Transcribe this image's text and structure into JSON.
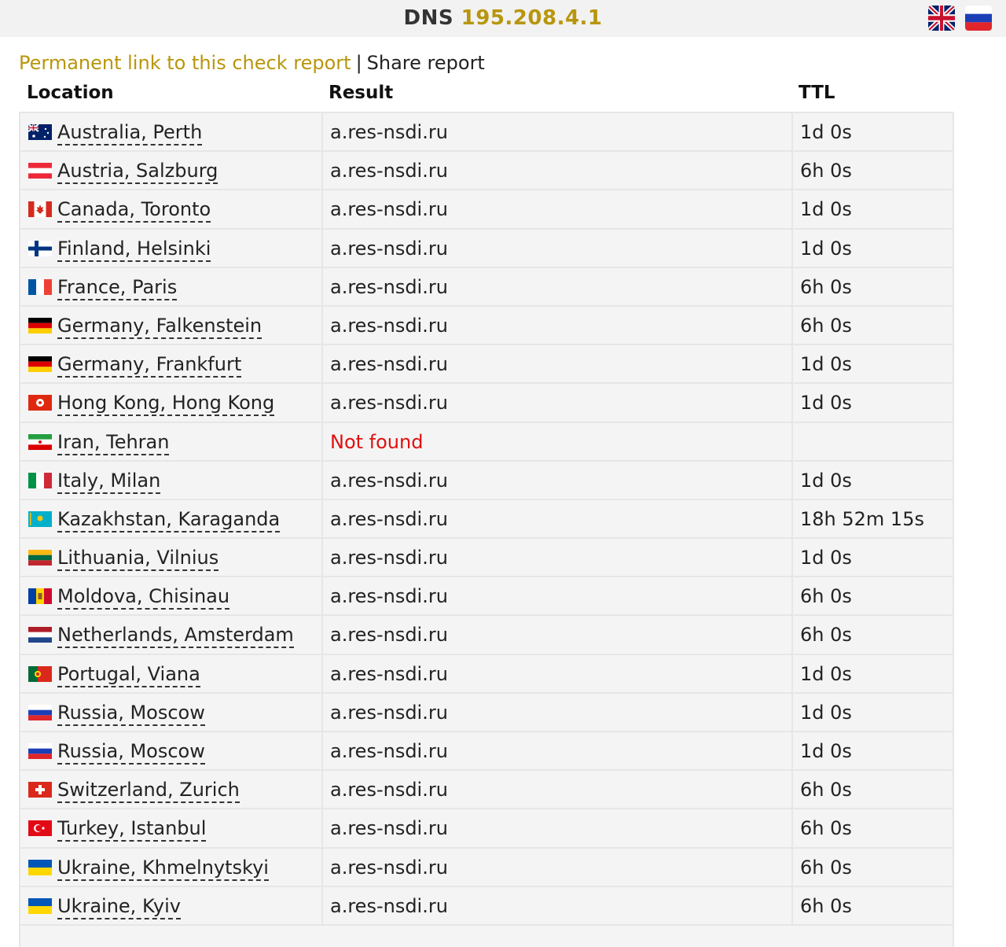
{
  "header": {
    "prefix": "DNS",
    "host": "195.208.4.1"
  },
  "lang": {
    "en_flag": "flag-gb-icon",
    "ru_flag": "flag-ru-icon"
  },
  "links": {
    "permanent": "Permanent link to this check report",
    "separator": "|",
    "share": "Share report"
  },
  "columns": {
    "location": "Location",
    "result": "Result",
    "ttl": "TTL"
  },
  "colors": {
    "accent": "#b8960c",
    "error": "#e01010"
  },
  "rows": [
    {
      "flag": "au",
      "location": "Australia, Perth",
      "result": "a.res-nsdi.ru",
      "ttl": "1d 0s",
      "error": false
    },
    {
      "flag": "at",
      "location": "Austria, Salzburg",
      "result": "a.res-nsdi.ru",
      "ttl": "6h 0s",
      "error": false
    },
    {
      "flag": "ca",
      "location": "Canada, Toronto",
      "result": "a.res-nsdi.ru",
      "ttl": "1d 0s",
      "error": false
    },
    {
      "flag": "fi",
      "location": "Finland, Helsinki",
      "result": "a.res-nsdi.ru",
      "ttl": "1d 0s",
      "error": false
    },
    {
      "flag": "fr",
      "location": "France, Paris",
      "result": "a.res-nsdi.ru",
      "ttl": "6h 0s",
      "error": false
    },
    {
      "flag": "de",
      "location": "Germany, Falkenstein",
      "result": "a.res-nsdi.ru",
      "ttl": "6h 0s",
      "error": false
    },
    {
      "flag": "de",
      "location": "Germany, Frankfurt",
      "result": "a.res-nsdi.ru",
      "ttl": "1d 0s",
      "error": false
    },
    {
      "flag": "hk",
      "location": "Hong Kong, Hong Kong",
      "result": "a.res-nsdi.ru",
      "ttl": "1d 0s",
      "error": false
    },
    {
      "flag": "ir",
      "location": "Iran, Tehran",
      "result": "Not found",
      "ttl": "",
      "error": true
    },
    {
      "flag": "it",
      "location": "Italy, Milan",
      "result": "a.res-nsdi.ru",
      "ttl": "1d 0s",
      "error": false
    },
    {
      "flag": "kz",
      "location": "Kazakhstan, Karaganda",
      "result": "a.res-nsdi.ru",
      "ttl": "18h 52m 15s",
      "error": false
    },
    {
      "flag": "lt",
      "location": "Lithuania, Vilnius",
      "result": "a.res-nsdi.ru",
      "ttl": "1d 0s",
      "error": false
    },
    {
      "flag": "md",
      "location": "Moldova, Chisinau",
      "result": "a.res-nsdi.ru",
      "ttl": "6h 0s",
      "error": false
    },
    {
      "flag": "nl",
      "location": "Netherlands, Amsterdam",
      "result": "a.res-nsdi.ru",
      "ttl": "6h 0s",
      "error": false
    },
    {
      "flag": "pt",
      "location": "Portugal, Viana",
      "result": "a.res-nsdi.ru",
      "ttl": "1d 0s",
      "error": false
    },
    {
      "flag": "ru",
      "location": "Russia, Moscow",
      "result": "a.res-nsdi.ru",
      "ttl": "1d 0s",
      "error": false
    },
    {
      "flag": "ru",
      "location": "Russia, Moscow",
      "result": "a.res-nsdi.ru",
      "ttl": "1d 0s",
      "error": false
    },
    {
      "flag": "ch",
      "location": "Switzerland, Zurich",
      "result": "a.res-nsdi.ru",
      "ttl": "6h 0s",
      "error": false
    },
    {
      "flag": "tr",
      "location": "Turkey, Istanbul",
      "result": "a.res-nsdi.ru",
      "ttl": "6h 0s",
      "error": false
    },
    {
      "flag": "ua",
      "location": "Ukraine, Khmelnytskyi",
      "result": "a.res-nsdi.ru",
      "ttl": "6h 0s",
      "error": false
    },
    {
      "flag": "ua",
      "location": "Ukraine, Kyiv",
      "result": "a.res-nsdi.ru",
      "ttl": "6h 0s",
      "error": false
    }
  ]
}
